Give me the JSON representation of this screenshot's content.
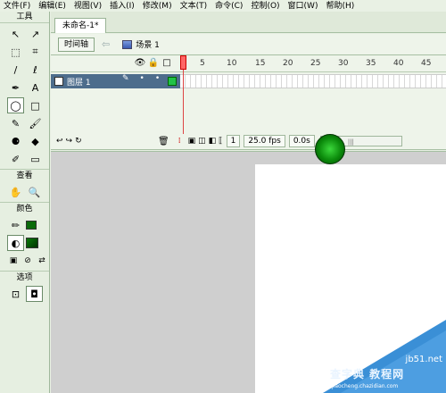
{
  "menu": [
    "文件(F)",
    "编辑(E)",
    "视图(V)",
    "插入(I)",
    "修改(M)",
    "文本(T)",
    "命令(C)",
    "控制(O)",
    "窗口(W)",
    "帮助(H)"
  ],
  "toolbox": {
    "header": "工具",
    "view_label": "查看",
    "color_label": "颜色",
    "options_label": "选项",
    "tools": [
      "↖",
      "↗",
      "⬚",
      "⌗",
      "/",
      "ℓ",
      "✒",
      "A",
      "◯",
      "□",
      "✎",
      "🖌",
      "⚈",
      "◆",
      "✐",
      "▭"
    ],
    "view_tools": [
      "✋",
      "🔍"
    ],
    "color_tools": [
      "✏",
      "◐"
    ],
    "color_row3": [
      "▣",
      "⊘",
      "⇄"
    ],
    "option_tools": [
      "⊡",
      "◘"
    ]
  },
  "document": {
    "tab_title": "未命名-1*"
  },
  "scenebar": {
    "timeline_button": "时间轴",
    "back": "⇦",
    "scene_label": "场景 1"
  },
  "timeline": {
    "ruler": [
      "5",
      "10",
      "15",
      "20",
      "25",
      "30",
      "35",
      "40",
      "45"
    ],
    "layer_name": "图层 1",
    "layer_marks": [
      "✎",
      "•",
      "•"
    ],
    "header_icons": [
      "👁",
      "🔒",
      "□"
    ],
    "current_frame": "1",
    "fps": "25.0 fps",
    "elapsed": "0.0s",
    "foot_icons": [
      "↩",
      "↪",
      "↻"
    ],
    "scroll_grip": "|||",
    "scroll_left": "◂"
  },
  "watermark": {
    "site": "jb51.net",
    "cn": "查字典 教程网",
    "url": "jiaocheng.chazidian.com"
  }
}
